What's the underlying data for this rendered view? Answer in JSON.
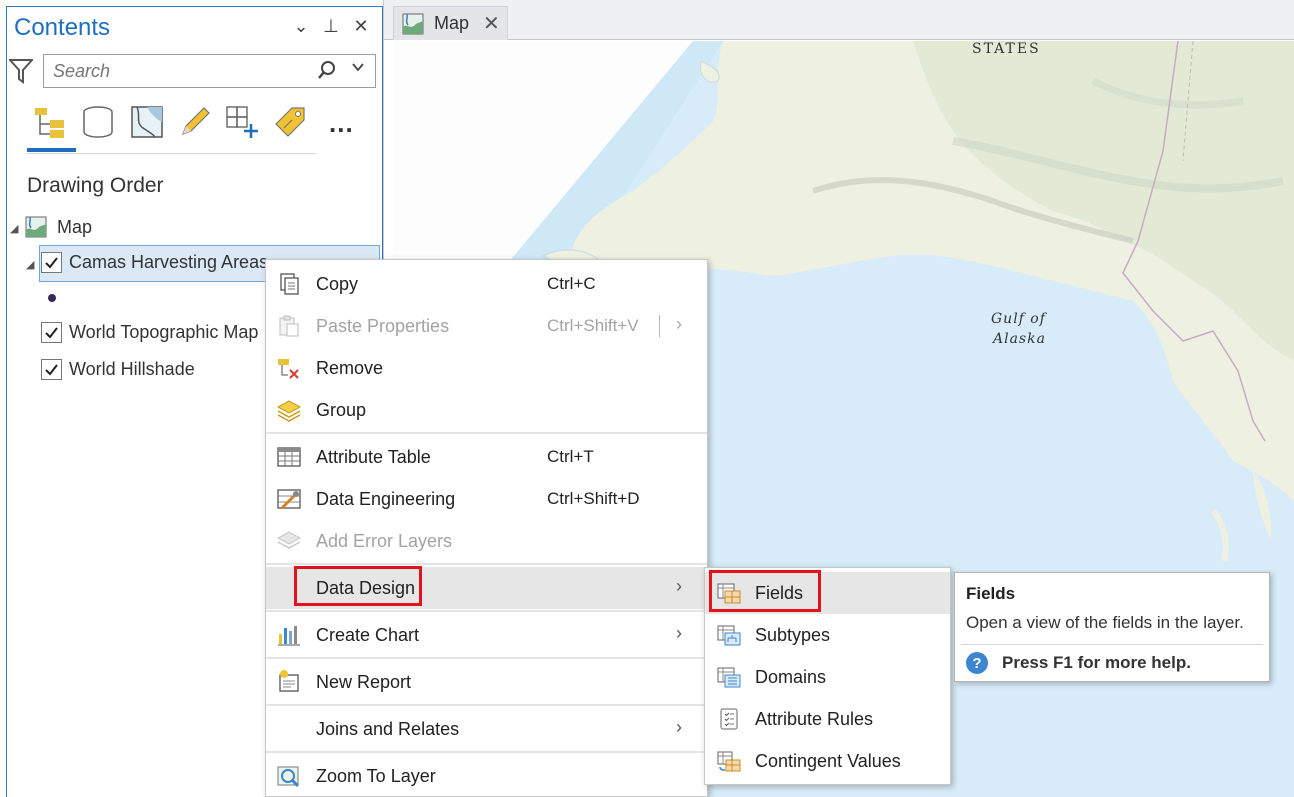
{
  "contents": {
    "title": "Contents",
    "controls": [
      "⌄",
      "⊥",
      "✕"
    ],
    "search_placeholder": "Search",
    "more_label": "...",
    "heading": "Drawing Order",
    "tree": {
      "map": "Map",
      "layer_selected": "Camas Harvesting Areas",
      "layer_topo": "World Topographic Map",
      "layer_hillshade": "World Hillshade"
    }
  },
  "map_tab": {
    "label": "Map",
    "close": "✕"
  },
  "map_labels": {
    "states": "STATES",
    "gulf_line1": "Gulf of",
    "gulf_line2": "Alaska"
  },
  "context_menu": {
    "copy": {
      "label": "Copy",
      "shortcut": "Ctrl+C"
    },
    "paste": {
      "label": "Paste Properties",
      "shortcut": "Ctrl+Shift+V"
    },
    "remove": {
      "label": "Remove"
    },
    "group": {
      "label": "Group"
    },
    "attribute_table": {
      "label": "Attribute Table",
      "shortcut": "Ctrl+T"
    },
    "data_engineering": {
      "label": "Data Engineering",
      "shortcut": "Ctrl+Shift+D"
    },
    "add_error_layers": {
      "label": "Add Error Layers"
    },
    "data_design": {
      "label": "Data Design"
    },
    "create_chart": {
      "label": "Create Chart"
    },
    "new_report": {
      "label": "New Report"
    },
    "joins_relates": {
      "label": "Joins and Relates"
    },
    "zoom_to_layer": {
      "label": "Zoom To Layer"
    },
    "arrow": "›"
  },
  "submenu": {
    "fields": "Fields",
    "subtypes": "Subtypes",
    "domains": "Domains",
    "attribute_rules": "Attribute Rules",
    "contingent_values": "Contingent Values"
  },
  "tooltip": {
    "title": "Fields",
    "description": "Open a view of the fields in the layer.",
    "help": "Press F1 for more help.",
    "help_glyph": "?"
  },
  "colors": {
    "accent": "#1e6fbf",
    "highlight_red": "#e3131b",
    "ocean": "#cfe8f6",
    "land": "#eef0e2"
  }
}
